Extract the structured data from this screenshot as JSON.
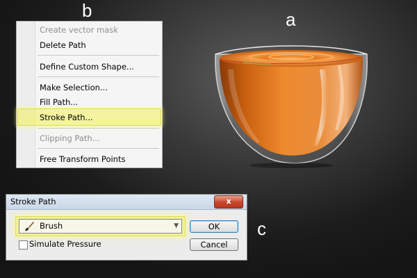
{
  "annotations": {
    "a": "a",
    "b": "b",
    "c": "c"
  },
  "context_menu": {
    "items": [
      {
        "label": "Create vector mask",
        "disabled": true
      },
      {
        "label": "Delete Path",
        "disabled": false
      },
      {
        "label": "Define Custom Shape...",
        "disabled": false
      },
      {
        "label": "Make Selection...",
        "disabled": false
      },
      {
        "label": "Fill Path...",
        "disabled": false
      },
      {
        "label": "Stroke Path...",
        "disabled": false,
        "highlighted": true
      },
      {
        "label": "Clipping Path...",
        "disabled": true
      },
      {
        "label": "Free Transform Points",
        "disabled": false
      }
    ],
    "highlight_color": "#f0f05a"
  },
  "dialog": {
    "title": "Stroke Path",
    "close_label": "x",
    "tool_select": {
      "value": "Brush",
      "icon": "brush-icon"
    },
    "simulate_pressure": {
      "label": "Simulate Pressure",
      "checked": false
    },
    "ok_label": "OK",
    "cancel_label": "Cancel"
  },
  "colors": {
    "background": "#2a2a2a",
    "liquid": "#e07a1e",
    "highlight": "#f4f464"
  }
}
